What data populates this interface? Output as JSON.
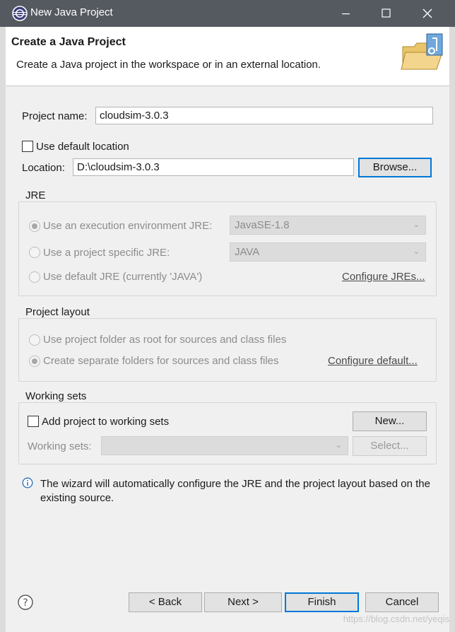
{
  "window": {
    "title": "New Java Project",
    "minimize_icon": "minimize-icon",
    "maximize_icon": "maximize-icon",
    "close_icon": "close-icon"
  },
  "header": {
    "title": "Create a Java Project",
    "description": "Create a Java project in the workspace or in an external location."
  },
  "project": {
    "name_label": "Project name:",
    "name_value": "cloudsim-3.0.3",
    "use_default_label": "Use default location",
    "use_default_checked": false,
    "location_label": "Location:",
    "location_value": "D:\\cloudsim-3.0.3",
    "browse_label": "Browse..."
  },
  "jre": {
    "title": "JRE",
    "option_env": "Use an execution environment JRE:",
    "env_value": "JavaSE-1.8",
    "option_specific": "Use a project specific JRE:",
    "specific_value": "JAVA",
    "option_default": "Use default JRE (currently 'JAVA')",
    "configure_link": "Configure JREs..."
  },
  "layout": {
    "title": "Project layout",
    "option_root": "Use project folder as root for sources and class files",
    "option_separate": "Create separate folders for sources and class files",
    "configure_link": "Configure default..."
  },
  "working_sets": {
    "title": "Working sets",
    "add_label": "Add project to working sets",
    "new_label": "New...",
    "sets_label": "Working sets:",
    "sets_value": "",
    "select_label": "Select..."
  },
  "info": {
    "text": "The wizard will automatically configure the JRE and the project layout based on the existing source."
  },
  "buttons": {
    "back": "< Back",
    "next": "Next >",
    "finish": "Finish",
    "cancel": "Cancel"
  },
  "watermark": "https://blog.csdn.net/yeqis",
  "colors": {
    "titlebar": "#555a60",
    "accent": "#0078d7",
    "info": "#2a6ebb"
  }
}
